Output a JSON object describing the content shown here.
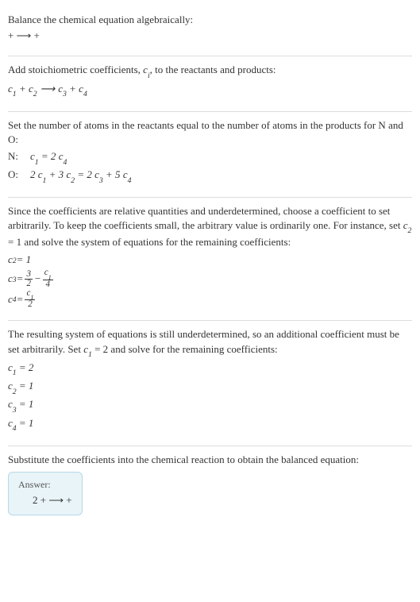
{
  "section1": {
    "title": "Balance the chemical equation algebraically:",
    "eq": " +  ⟶  + "
  },
  "section2": {
    "title_a": "Add stoichiometric coefficients, ",
    "ci": "c",
    "ci_sub": "i",
    "title_b": ", to the reactants and products:",
    "c1": "c",
    "s1": "1",
    "plus1": " + ",
    "c2": "c",
    "s2": "2",
    "arrow": " ⟶ ",
    "c3": "c",
    "s3": "3",
    "plus2": " + ",
    "c4": "c",
    "s4": "4"
  },
  "section3": {
    "title": "Set the number of atoms in the reactants equal to the number of atoms in the products for N and O:",
    "rowN": {
      "label": "N: ",
      "lhs_c": "c",
      "lhs_s": "1",
      "eq": " = 2 ",
      "rhs_c": "c",
      "rhs_s": "4"
    },
    "rowO": {
      "label": "O: ",
      "p1": "2 ",
      "c1": "c",
      "s1": "1",
      "p2": " + 3 ",
      "c2": "c",
      "s2": "2",
      "p3": " = 2 ",
      "c3": "c",
      "s3": "3",
      "p4": " + 5 ",
      "c4": "c",
      "s4": "4"
    }
  },
  "section4": {
    "title_a": "Since the coefficients are relative quantities and underdetermined, choose a coefficient to set arbitrarily. To keep the coefficients small, the arbitrary value is ordinarily one. For instance, set ",
    "cv": "c",
    "cvs": "2",
    "title_b": " = 1 and solve the system of equations for the remaining coefficients:",
    "line1": {
      "c": "c",
      "s": "2",
      "rest": " = 1"
    },
    "line2": {
      "c": "c",
      "s": "3",
      "eq": " = ",
      "f1n": "3",
      "f1d": "2",
      "minus": " − ",
      "f2n_c": "c",
      "f2n_s": "1",
      "f2d": "4"
    },
    "line3": {
      "c": "c",
      "s": "4",
      "eq": " = ",
      "fn_c": "c",
      "fn_s": "1",
      "fd": "2"
    }
  },
  "section5": {
    "title_a": "The resulting system of equations is still underdetermined, so an additional coefficient must be set arbitrarily. Set ",
    "cv": "c",
    "cvs": "1",
    "title_b": " = 2 and solve for the remaining coefficients:",
    "l1": {
      "c": "c",
      "s": "1",
      "v": " = 2"
    },
    "l2": {
      "c": "c",
      "s": "2",
      "v": " = 1"
    },
    "l3": {
      "c": "c",
      "s": "3",
      "v": " = 1"
    },
    "l4": {
      "c": "c",
      "s": "4",
      "v": " = 1"
    }
  },
  "section6": {
    "title": "Substitute the coefficients into the chemical reaction to obtain the balanced equation:",
    "answer_label": "Answer:",
    "answer_eq": "2  +  ⟶  + "
  }
}
